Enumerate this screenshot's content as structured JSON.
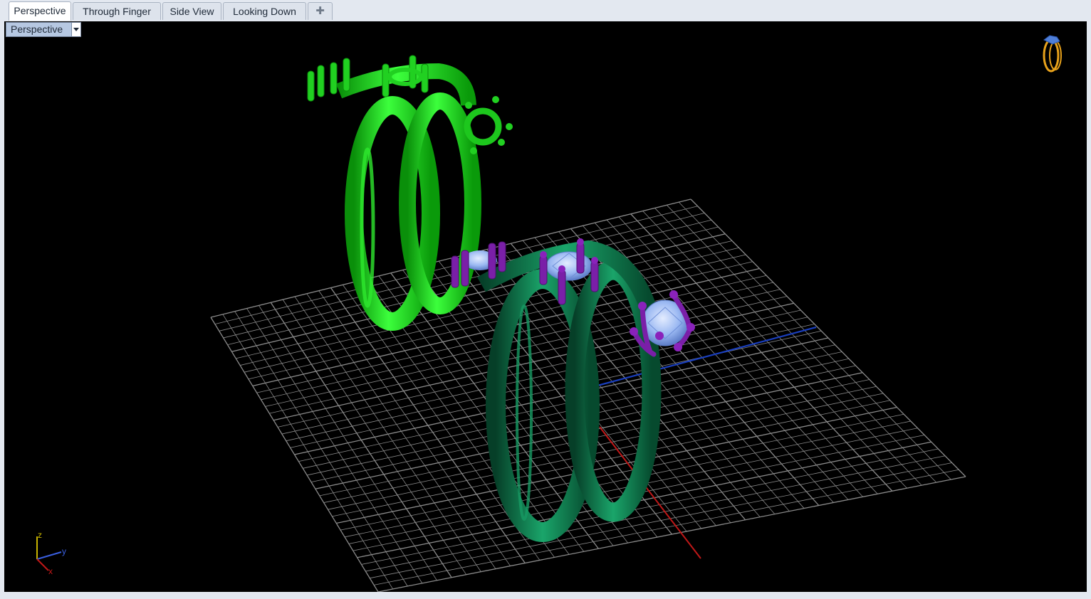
{
  "tabs": [
    {
      "label": "Perspective",
      "active": true
    },
    {
      "label": "Through Finger",
      "active": false
    },
    {
      "label": "Side View",
      "active": false
    },
    {
      "label": "Looking Down",
      "active": false
    }
  ],
  "add_tab_icon": "plus-icon",
  "viewport": {
    "label": "Perspective",
    "dropdown_icon": "chevron-down-icon",
    "background": "#000000"
  },
  "axis_indicator": {
    "z": "z",
    "y": "y",
    "x": "x"
  },
  "corner_icon": "ring-icon",
  "colors": {
    "ring_bright": "#1fd61f",
    "ring_dark": "#0e7a4d",
    "prongs": "#7a1fa8",
    "stones": "#8fb1f0",
    "grid": "#9a9a9a",
    "axis_x": "#c01818",
    "axis_y": "#1a3fbf"
  }
}
